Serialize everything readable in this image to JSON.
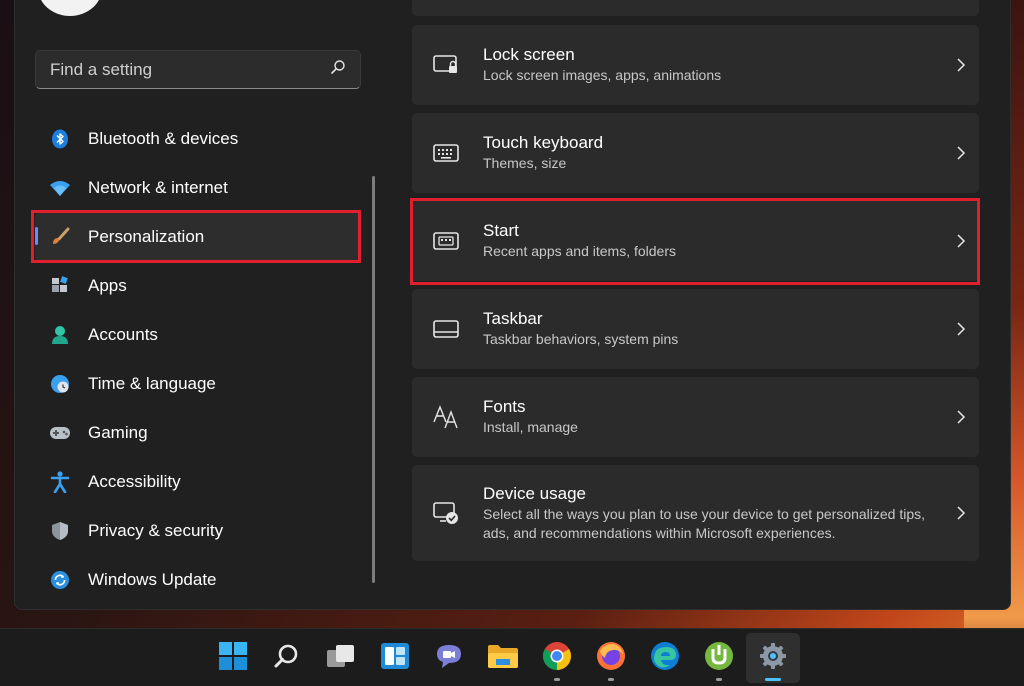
{
  "search": {
    "placeholder": "Find a setting"
  },
  "nav": {
    "items": [
      {
        "label": "Bluetooth & devices",
        "icon": "bluetooth-icon"
      },
      {
        "label": "Network & internet",
        "icon": "wifi-icon"
      },
      {
        "label": "Personalization",
        "icon": "brush-icon",
        "selected": true
      },
      {
        "label": "Apps",
        "icon": "apps-icon"
      },
      {
        "label": "Accounts",
        "icon": "person-icon"
      },
      {
        "label": "Time & language",
        "icon": "globe-clock-icon"
      },
      {
        "label": "Gaming",
        "icon": "gamepad-icon"
      },
      {
        "label": "Accessibility",
        "icon": "accessibility-icon"
      },
      {
        "label": "Privacy & security",
        "icon": "shield-icon"
      },
      {
        "label": "Windows Update",
        "icon": "update-icon"
      }
    ]
  },
  "settings": {
    "cards": [
      {
        "title": "Lock screen",
        "subtitle": "Lock screen images, apps, animations",
        "icon": "lock-screen-icon"
      },
      {
        "title": "Touch keyboard",
        "subtitle": "Themes, size",
        "icon": "keyboard-icon"
      },
      {
        "title": "Start",
        "subtitle": "Recent apps and items, folders",
        "icon": "start-icon",
        "highlighted": true
      },
      {
        "title": "Taskbar",
        "subtitle": "Taskbar behaviors, system pins",
        "icon": "taskbar-icon"
      },
      {
        "title": "Fonts",
        "subtitle": "Install, manage",
        "icon": "fonts-icon"
      },
      {
        "title": "Device usage",
        "subtitle": "Select all the ways you plan to use your device to get personalized tips, ads, and recommendations within Microsoft experiences.",
        "icon": "device-usage-icon"
      }
    ]
  },
  "taskbar": {
    "apps": [
      "windows-start-icon",
      "search-icon",
      "task-view-icon",
      "widgets-icon",
      "teams-chat-icon",
      "file-explorer-icon",
      "chrome-icon",
      "firefox-icon",
      "edge-icon",
      "utorrent-icon",
      "settings-gear-icon"
    ]
  },
  "colors": {
    "highlight_border": "#e0202e",
    "accent": "#4cc2ff",
    "selected_indicator": "#6b8cff",
    "window_bg": "#202020",
    "card_bg": "#2b2b2b"
  }
}
